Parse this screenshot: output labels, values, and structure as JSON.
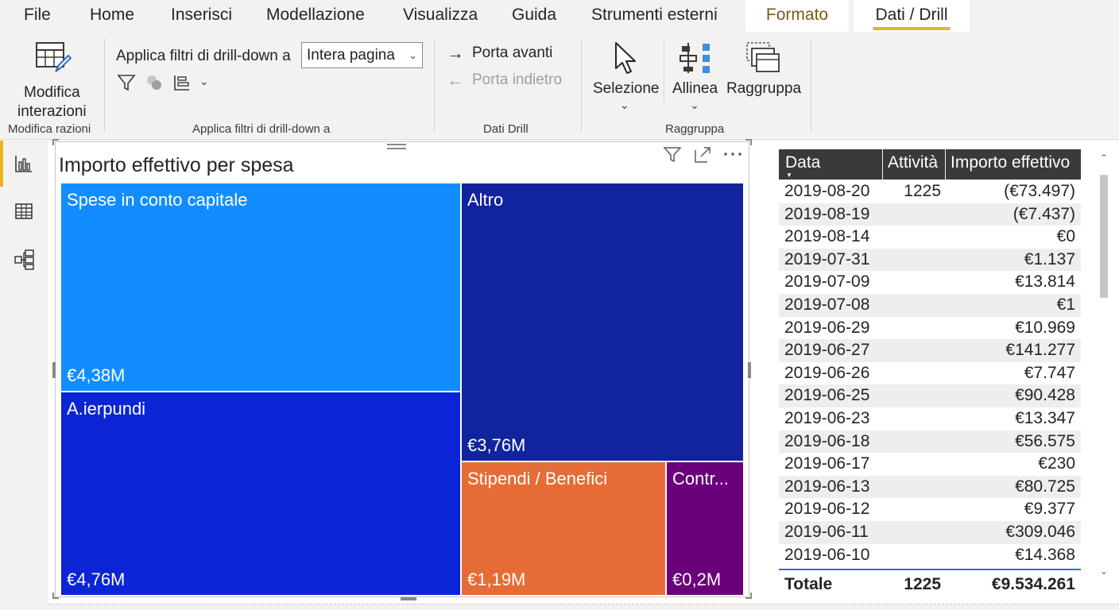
{
  "menu": {
    "items": [
      "File",
      "Home",
      "Inserisci",
      "Modellazione",
      "Visualizza",
      "Guida",
      "Strumenti esterni"
    ],
    "tab_formato": "Formato",
    "tab_dati": "Dati / Drill"
  },
  "ribbon": {
    "modify_interactions": {
      "line1": "Modifica",
      "line2": "interazioni",
      "group": "Modifica razioni"
    },
    "drill_filters": {
      "label": "Applica filtri di drill-down a",
      "selected": "Intera pagina",
      "group": "Applica filtri di drill-down a"
    },
    "drill": {
      "forward": "Porta avanti",
      "back": "Porta indietro",
      "group": "Dati Drill"
    },
    "arrange": {
      "selection": "Selezione",
      "align": "Allinea",
      "group_btn": "Raggruppa",
      "group": "Raggruppa"
    }
  },
  "treemap": {
    "title": "Importo effettivo per spesa",
    "tiles": [
      {
        "name": "Spese in conto capitale",
        "value_label": "€4,38M",
        "value": 4.38,
        "color": "#118dff"
      },
      {
        "name": "A.ierpundi",
        "value_label": "€4,76M",
        "value": 4.76,
        "color": "#0b25d6"
      },
      {
        "name": "Altro",
        "value_label": "€3,76M",
        "value": 3.76,
        "color": "#12239e"
      },
      {
        "name": "Stipendi / Benefici",
        "value_label": "€1,19M",
        "value": 1.19,
        "color": "#e66c37"
      },
      {
        "name": "Contr...",
        "value_label": "€0,2M",
        "value": 0.2,
        "color": "#6b007b"
      }
    ]
  },
  "table": {
    "headers": [
      "Data",
      "Attività",
      "Importo effettivo"
    ],
    "rows": [
      {
        "date": "2019-08-20",
        "activity": "1225",
        "amount": "(€73.497)"
      },
      {
        "date": "2019-08-19",
        "activity": "",
        "amount": "(€7.437)"
      },
      {
        "date": "2019-08-14",
        "activity": "",
        "amount": "€0"
      },
      {
        "date": "2019-07-31",
        "activity": "",
        "amount": "€1.137"
      },
      {
        "date": "2019-07-09",
        "activity": "",
        "amount": "€13.814"
      },
      {
        "date": "2019-07-08",
        "activity": "",
        "amount": "€1"
      },
      {
        "date": "2019-06-29",
        "activity": "",
        "amount": "€10.969"
      },
      {
        "date": "2019-06-27",
        "activity": "",
        "amount": "€141.277"
      },
      {
        "date": "2019-06-26",
        "activity": "",
        "amount": "€7.747"
      },
      {
        "date": "2019-06-25",
        "activity": "",
        "amount": "€90.428"
      },
      {
        "date": "2019-06-23",
        "activity": "",
        "amount": "€13.347"
      },
      {
        "date": "2019-06-18",
        "activity": "",
        "amount": "€56.575"
      },
      {
        "date": "2019-06-17",
        "activity": "",
        "amount": "€230"
      },
      {
        "date": "2019-06-13",
        "activity": "",
        "amount": "€80.725"
      },
      {
        "date": "2019-06-12",
        "activity": "",
        "amount": "€9.377"
      },
      {
        "date": "2019-06-11",
        "activity": "",
        "amount": "€309.046"
      },
      {
        "date": "2019-06-10",
        "activity": "",
        "amount": "€14.368"
      }
    ],
    "total": {
      "label": "Totale",
      "activity": "1225",
      "amount": "€9.534.261"
    }
  }
}
